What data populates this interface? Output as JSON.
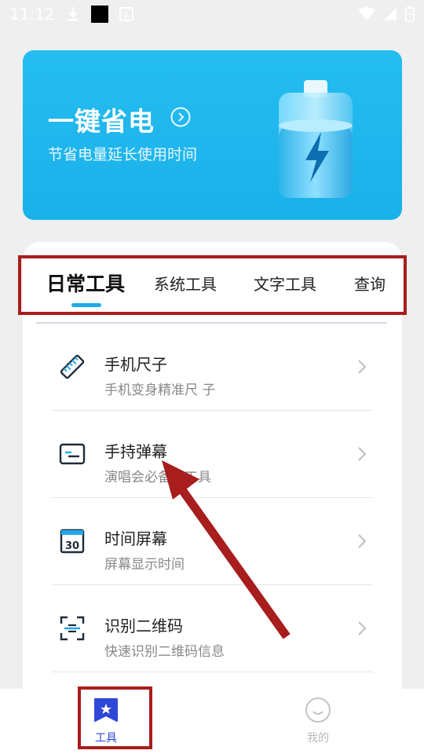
{
  "status_bar": {
    "time": "11:12",
    "download_icon": "download-icon",
    "app_icon": "a-icon"
  },
  "banner": {
    "title": "一键省电",
    "subtitle": "节省电量延长使用时间"
  },
  "tabs": [
    {
      "label": "日常工具",
      "active": true
    },
    {
      "label": "系统工具",
      "active": false
    },
    {
      "label": "文字工具",
      "active": false
    },
    {
      "label": "查询",
      "active": false
    }
  ],
  "tools": [
    {
      "title": "手机尺子",
      "subtitle": "手机变身精准尺 子",
      "icon": "ruler-icon"
    },
    {
      "title": "手持弹幕",
      "subtitle": "演唱会必备小工具",
      "icon": "danmaku-icon"
    },
    {
      "title": "时间屏幕",
      "subtitle": "屏幕显示时间",
      "icon": "calendar-icon",
      "icon_text": "30"
    },
    {
      "title": "识别二维码",
      "subtitle": "快速识别二维码信息",
      "icon": "scan-icon"
    }
  ],
  "bottom_nav": [
    {
      "label": "工具",
      "active": true
    },
    {
      "label": "我的",
      "active": false
    }
  ],
  "colors": {
    "accent": "#20a8e8",
    "banner": "#1fb6ec",
    "nav_active": "#2f47d8",
    "annotation": "#a81d1d"
  }
}
